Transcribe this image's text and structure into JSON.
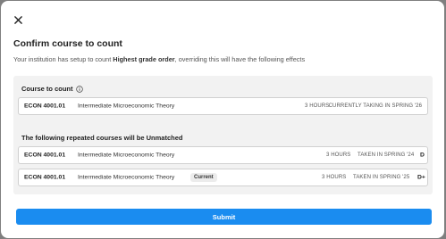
{
  "dialog": {
    "title": "Confirm course to count",
    "subtitle_prefix": "Your institution has setup to count ",
    "subtitle_policy": "Highest grade order",
    "subtitle_suffix": ", overriding this will have the following effects"
  },
  "course_to_count": {
    "label": "Course to count",
    "info_icon": "info-circle-icon",
    "course": {
      "code": "ECON 4001.01",
      "name": "Intermediate Microeconomic Theory",
      "hours": "3 HOURS",
      "status": "CURRENTLY TAKING IN SPRING '26"
    }
  },
  "unmatched": {
    "label": "The following repeated courses will be Unmatched",
    "courses": [
      {
        "code": "ECON 4001.01",
        "name": "Intermediate Microeconomic Theory",
        "badge": "",
        "hours": "3 HOURS",
        "status": "TAKEN IN SPRING '24",
        "grade": "D"
      },
      {
        "code": "ECON 4001.01",
        "name": "Intermediate Microeconomic Theory",
        "badge": "Current",
        "hours": "3 HOURS",
        "status": "TAKEN IN SPRING '25",
        "grade": "D+"
      }
    ]
  },
  "actions": {
    "submit_label": "Submit",
    "close_icon": "close-icon"
  },
  "colors": {
    "primary": "#1a8cf0",
    "panel_bg": "#f2f2f2",
    "overlay": "#7f7f7f"
  }
}
